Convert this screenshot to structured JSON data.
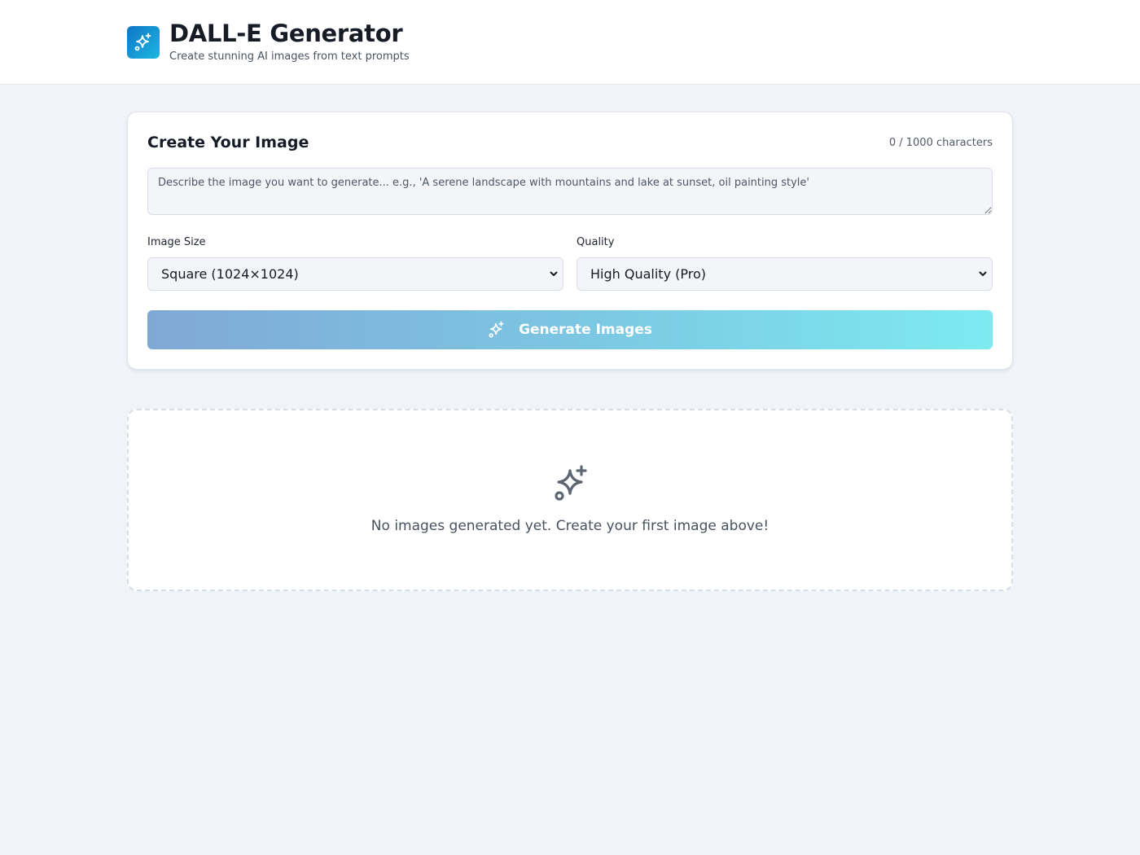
{
  "header": {
    "title": "DALL-E Generator",
    "subtitle": "Create stunning AI images from text prompts",
    "logo_icon": "sparkles-icon",
    "logo_color_start": "#0f75c7",
    "logo_color_end": "#1db8e0"
  },
  "form": {
    "title": "Create Your Image",
    "char_count": "0 / 1000 characters",
    "prompt": {
      "value": "",
      "placeholder": "Describe the image you want to generate... e.g., 'A serene landscape with mountains and lake at sunset, oil painting style'"
    },
    "size": {
      "label": "Image Size",
      "selected": "Square (1024×1024)"
    },
    "quality": {
      "label": "Quality",
      "selected": "High Quality (Pro)"
    },
    "generate_label": "Generate Images",
    "generate_icon": "sparkles-icon",
    "generate_gradient": [
      "#80a8d6",
      "#7cc6e2",
      "#7deaf0"
    ]
  },
  "empty_state": {
    "icon": "sparkles-icon",
    "message": "No images generated yet. Create your first image above!"
  }
}
